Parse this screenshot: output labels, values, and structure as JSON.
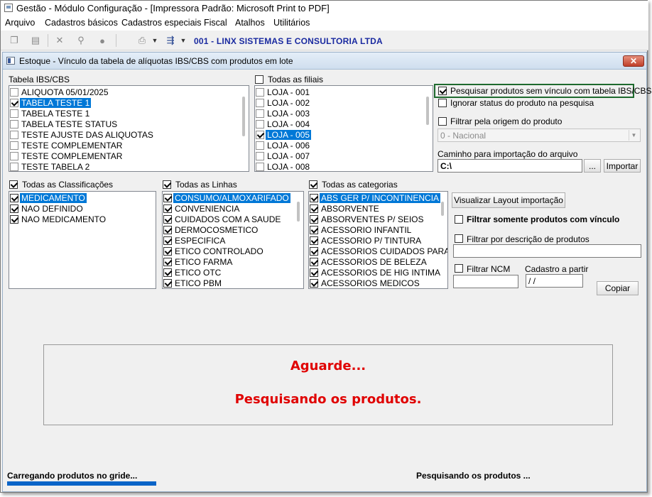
{
  "app": {
    "title": "Gestão  - Módulo Configuração - [Impressora Padrão: Microsoft Print to PDF]",
    "menu": [
      "Arquivo",
      "Cadastros básicos",
      "Cadastros especiais",
      "Fiscal",
      "Atalhos",
      "Utilitários"
    ],
    "company": "001 - LINX SISTEMAS E CONSULTORIA LTDA"
  },
  "dialog": {
    "title": "Estoque - Vínculo da tabela de alíquotas IBS/CBS com produtos em lote",
    "close": "✕"
  },
  "tabela": {
    "label": "Tabela IBS/CBS",
    "items": [
      {
        "text": "ALIQUOTA 05/01/2025",
        "checked": false,
        "selected": false
      },
      {
        "text": "TABELA TESTE 1",
        "checked": true,
        "selected": true
      },
      {
        "text": "TABELA TESTE 1",
        "checked": false,
        "selected": false
      },
      {
        "text": "TABELA TESTE STATUS",
        "checked": false,
        "selected": false
      },
      {
        "text": "TESTE AJUSTE DAS ALIQUOTAS",
        "checked": false,
        "selected": false
      },
      {
        "text": "TESTE COMPLEMENTAR",
        "checked": false,
        "selected": false
      },
      {
        "text": "TESTE COMPLEMENTAR",
        "checked": false,
        "selected": false
      },
      {
        "text": "TESTE TABELA 2",
        "checked": false,
        "selected": false
      }
    ]
  },
  "filiais": {
    "label": "Todas as filiais",
    "all_checked": false,
    "items": [
      {
        "text": "LOJA - 001",
        "checked": false,
        "selected": false
      },
      {
        "text": "LOJA - 002",
        "checked": false,
        "selected": false
      },
      {
        "text": "LOJA - 003",
        "checked": false,
        "selected": false
      },
      {
        "text": "LOJA - 004",
        "checked": false,
        "selected": false
      },
      {
        "text": "LOJA - 005",
        "checked": true,
        "selected": true
      },
      {
        "text": "LOJA - 006",
        "checked": false,
        "selected": false
      },
      {
        "text": "LOJA - 007",
        "checked": false,
        "selected": false
      },
      {
        "text": "LOJA - 008",
        "checked": false,
        "selected": false
      }
    ]
  },
  "options": {
    "sem_vinculo": {
      "label": "Pesquisar produtos sem vínculo com tabela IBS/CBS",
      "checked": true
    },
    "ignorar_status": {
      "label": "Ignorar status do produto na pesquisa",
      "checked": false
    },
    "filtrar_origem": {
      "label": "Filtrar pela origem do produto",
      "checked": false
    },
    "origem_value": "0 - Nacional",
    "caminho_label": "Caminho para importação do arquivo",
    "caminho_value": "C:\\",
    "browse_label": "...",
    "importar_label": "Importar"
  },
  "classificacoes": {
    "label": "Todas as Classificações",
    "all_checked": true,
    "items": [
      {
        "text": "MEDICAMENTO",
        "checked": true,
        "selected": true
      },
      {
        "text": "NAO DEFINIDO",
        "checked": true,
        "selected": false
      },
      {
        "text": "NAO MEDICAMENTO",
        "checked": true,
        "selected": false
      }
    ]
  },
  "linhas": {
    "label": "Todas as Linhas",
    "all_checked": true,
    "items": [
      {
        "text": "CONSUMO/ALMOXARIFADO",
        "checked": true,
        "selected": true
      },
      {
        "text": "CONVENIENCIA",
        "checked": true,
        "selected": false
      },
      {
        "text": "CUIDADOS COM A SAUDE",
        "checked": true,
        "selected": false
      },
      {
        "text": "DERMOCOSMETICO",
        "checked": true,
        "selected": false
      },
      {
        "text": "ESPECIFICA",
        "checked": true,
        "selected": false
      },
      {
        "text": "ETICO CONTROLADO",
        "checked": true,
        "selected": false
      },
      {
        "text": "ETICO FARMA",
        "checked": true,
        "selected": false
      },
      {
        "text": "ETICO OTC",
        "checked": true,
        "selected": false
      },
      {
        "text": "ETICO PBM",
        "checked": true,
        "selected": false
      }
    ]
  },
  "categorias": {
    "label": "Todas as categorias",
    "all_checked": true,
    "items": [
      {
        "text": "ABS GER P/ INCONTINENCIA",
        "checked": true,
        "selected": true
      },
      {
        "text": "ABSORVENTE",
        "checked": true,
        "selected": false
      },
      {
        "text": "ABSORVENTES P/ SEIOS",
        "checked": true,
        "selected": false
      },
      {
        "text": "ACESSORIO INFANTIL",
        "checked": true,
        "selected": false
      },
      {
        "text": "ACESSORIO P/ TINTURA",
        "checked": true,
        "selected": false
      },
      {
        "text": "ACESSORIOS CUIDADOS PARA",
        "checked": true,
        "selected": false
      },
      {
        "text": "ACESSORIOS DE BELEZA",
        "checked": true,
        "selected": false
      },
      {
        "text": "ACESSORIOS DE HIG INTIMA",
        "checked": true,
        "selected": false
      },
      {
        "text": "ACESSORIOS MEDICOS",
        "checked": true,
        "selected": false
      }
    ]
  },
  "filters": {
    "layout_button": "Visualizar Layout  importação",
    "somente_vinculo": {
      "label": "Filtrar somente produtos com vínculo",
      "checked": false
    },
    "descricao": {
      "label": "Filtrar por descrição de produtos",
      "checked": false,
      "value": ""
    },
    "ncm": {
      "label": "Filtrar NCM",
      "checked": false,
      "value": ""
    },
    "cadastro": {
      "label": "Cadastro a partir",
      "value": " /  /"
    },
    "copiar_label": "Copiar"
  },
  "status_panel": {
    "line1": "Aguarde...",
    "line2": "Pesquisando os produtos."
  },
  "statusbar": {
    "left": "Carregando produtos no gride...",
    "right": "Pesquisando os produtos ...",
    "progress": 1.0
  }
}
